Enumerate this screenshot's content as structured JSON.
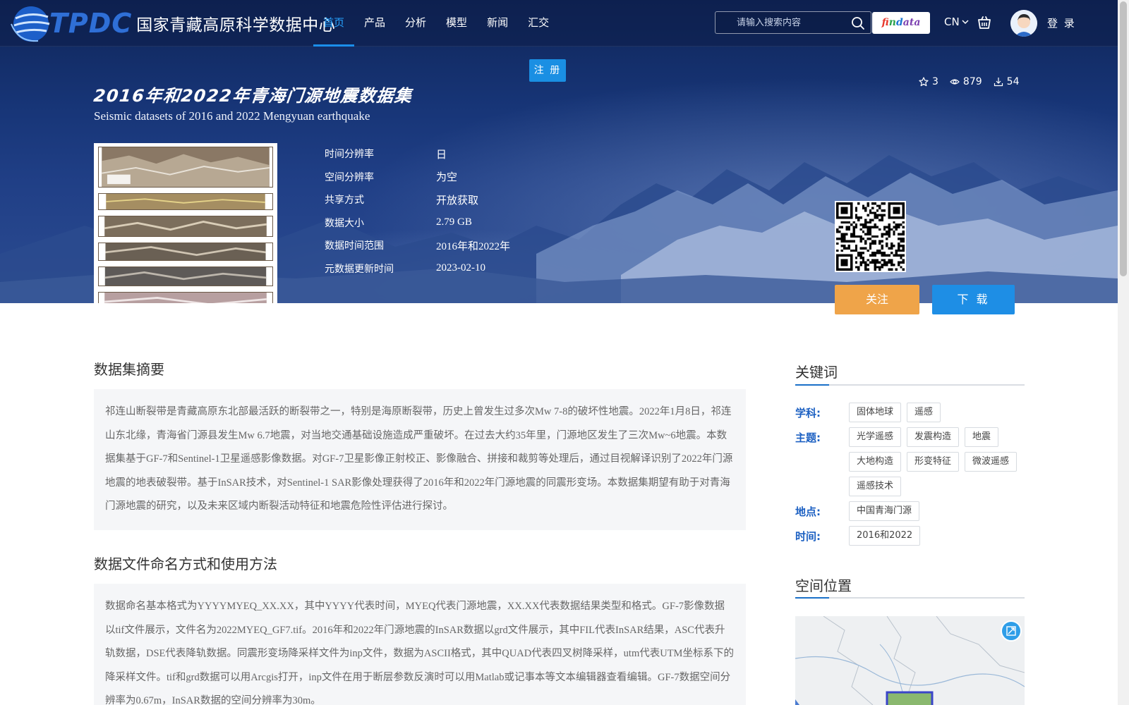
{
  "header": {
    "logo_abbr": "TPDC",
    "logo_name": "国家青藏高原科学数据中心",
    "nav": [
      {
        "label": "首页",
        "active": true
      },
      {
        "label": "产品",
        "active": false
      },
      {
        "label": "分析",
        "active": false
      },
      {
        "label": "模型",
        "active": false
      },
      {
        "label": "新闻",
        "active": false
      },
      {
        "label": "汇交",
        "active": false
      }
    ],
    "search_placeholder": "请输入搜索内容",
    "findata": [
      "f",
      "i",
      "n",
      "d",
      "ata"
    ],
    "language": "CN",
    "login_label": "登 录",
    "register_label": "注 册"
  },
  "dataset": {
    "title_cn": "2016年和2022年青海门源地震数据集",
    "title_en": "Seismic datasets of 2016 and 2022 Mengyuan earthquake",
    "stats": {
      "favorites": "3",
      "views": "879",
      "downloads": "54"
    },
    "meta": [
      {
        "key": "时间分辨率",
        "value": "日"
      },
      {
        "key": "空间分辨率",
        "value": "为空"
      },
      {
        "key": "共享方式",
        "value": "开放获取"
      },
      {
        "key": "数据大小",
        "value": "2.79 GB"
      },
      {
        "key": "数据时间范围",
        "value": "2016年和2022年"
      },
      {
        "key": "元数据更新时间",
        "value": "2023-02-10"
      }
    ],
    "follow_label": "关注",
    "download_label": "下 载"
  },
  "abstract": {
    "title": "数据集摘要",
    "text": "祁连山断裂带是青藏高原东北部最活跃的断裂带之一，特别是海原断裂带，历史上曾发生过多次Mw 7-8的破坏性地震。2022年1月8日，祁连山东北缘，青海省门源县发生Mw 6.7地震，对当地交通基础设施造成严重破坏。在过去大约35年里，门源地区发生了三次Mw~6地震。本数据集基于GF-7和Sentinel-1卫星遥感影像数据。对GF-7卫星影像正射校正、影像融合、拼接和裁剪等处理后，通过目视解译识别了2022年门源地震的地表破裂带。基于InSAR技术，对Sentinel-1 SAR影像处理获得了2016年和2022年门源地震的同震形变场。本数据集期望有助于对青海门源地震的研究，以及未来区域内断裂活动特征和地震危险性评估进行探讨。"
  },
  "usage": {
    "title": "数据文件命名方式和使用方法",
    "text": "数据命名基本格式为YYYYMYEQ_XX.XX，其中YYYY代表时间，MYEQ代表门源地震，XX.XX代表数据结果类型和格式。GF-7影像数据以tif文件展示，文件名为2022MYEQ_GF7.tif。2016年和2022年门源地震的InSAR数据以grd文件展示，其中FIL代表InSAR结果，ASC代表升轨数据，DSE代表降轨数据。同震形变场降采样文件为inp文件，数据为ASCII格式，其中QUAD代表四叉树降采样，utm代表UTM坐标系下的降采样文件。tif和grd数据可以用Arcgis打开，inp文件在用于断层参数反演时可以用Matlab或记事本等文本编辑器查看编辑。GF-7数据空间分辨率为0.67m，InSAR数据的空间分辨率为30m。"
  },
  "keywords": {
    "title": "关键词",
    "groups": [
      {
        "label": "学科:",
        "tags": [
          "固体地球",
          "遥感"
        ]
      },
      {
        "label": "主题:",
        "tags": [
          "光学遥感",
          "发震构造",
          "地震",
          "大地构造",
          "形变特征",
          "微波遥感",
          "遥感技术"
        ]
      },
      {
        "label": "地点:",
        "tags": [
          "中国青海门源"
        ]
      },
      {
        "label": "时间:",
        "tags": [
          "2016和2022"
        ]
      }
    ]
  },
  "spatial": {
    "title": "空间位置"
  },
  "colors": {
    "accent": "#1a8fe3",
    "follow": "#efa449",
    "keyword_label": "#1c60c2",
    "hero_dark": "#0f2558"
  }
}
